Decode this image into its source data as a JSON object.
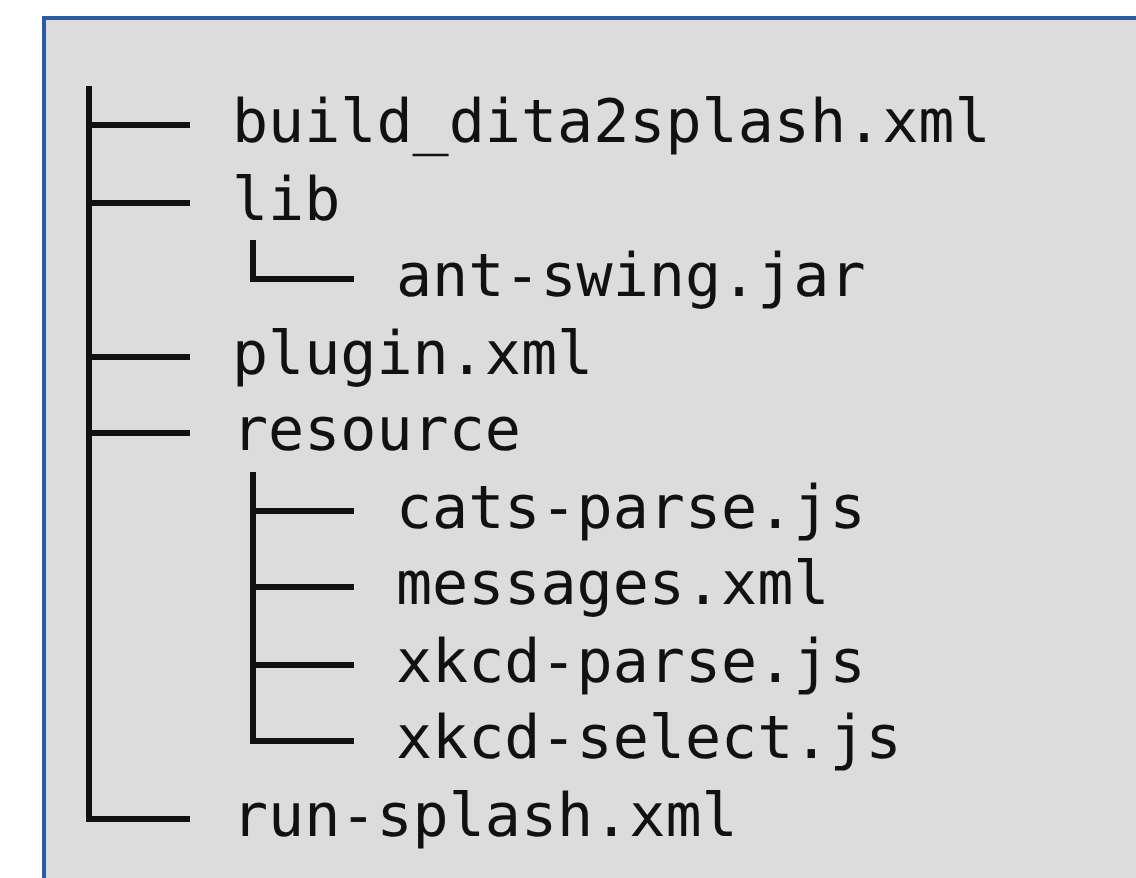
{
  "tree": [
    {
      "name": "build_dita2splash.xml"
    },
    {
      "name": "lib",
      "children": [
        {
          "name": "ant-swing.jar"
        }
      ]
    },
    {
      "name": "plugin.xml"
    },
    {
      "name": "resource",
      "children": [
        {
          "name": "cats-parse.js"
        },
        {
          "name": "messages.xml"
        },
        {
          "name": "xkcd-parse.js"
        },
        {
          "name": "xkcd-select.js"
        }
      ]
    },
    {
      "name": "run-splash.xml"
    }
  ]
}
